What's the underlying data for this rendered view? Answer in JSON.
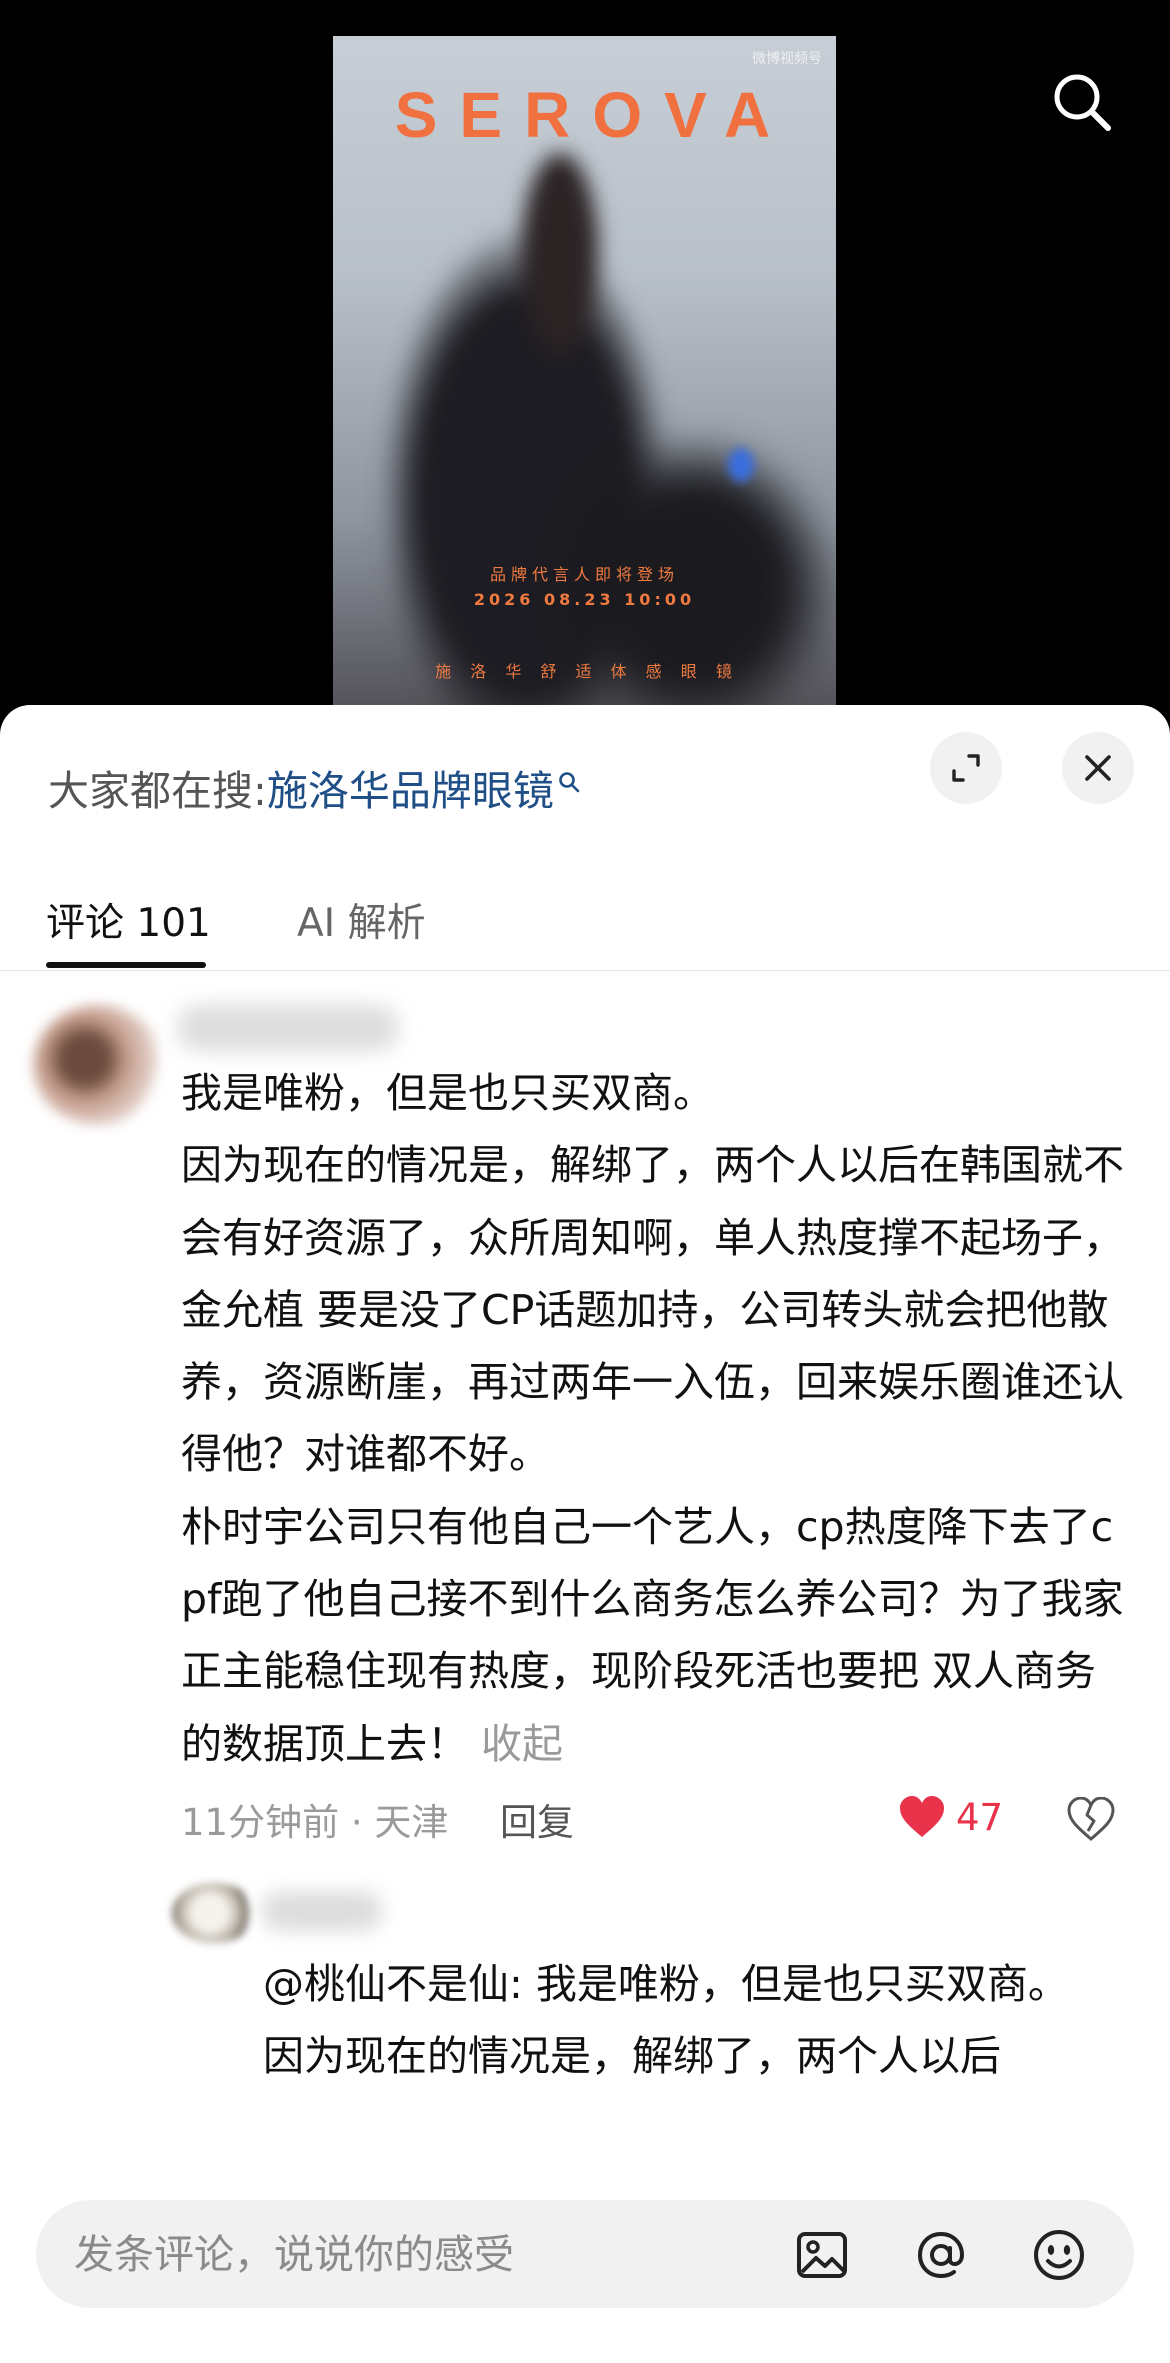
{
  "poster": {
    "brand": "SEROVA",
    "watermark": "微博视频号",
    "line1": "品牌代言人即将登场",
    "line2": "2026 08.23 10:00",
    "line3": "施 洛 华   舒 适 体 感 眼 镜"
  },
  "panel": {
    "search_prefix": "大家都在搜:",
    "search_keyword": "施洛华品牌眼镜"
  },
  "tabs": [
    {
      "label": "评论 101"
    },
    {
      "label": "AI 解析"
    }
  ],
  "comment": {
    "text": "我是唯粉，但是也只买双商。\n因为现在的情况是，解绑了，两个人以后在韩国就不会有好资源了，众所周知啊，单人热度撑不起场子， 金允植 要是没了CP话题加持，公司转头就会把他散养，资源断崖，再过两年一入伍，回来娱乐圈谁还认得他？对谁都不好。\n朴时宇公司只有他自己一个艺人，cp热度降下去了cpf跑了他自己接不到什么商务怎么养公司？为了我家正主能稳住现有热度，现阶段死活也要把 双人商务  的数据顶上去！",
    "collapse_label": "收起",
    "time_location": "11分钟前 · 天津",
    "reply_label": "回复",
    "like_count": "47"
  },
  "reply": {
    "text": "@桃仙不是仙: 我是唯粉，但是也只买双商。\n因为现在的情况是，解绑了，两个人以后"
  },
  "input": {
    "placeholder": "发条评论，说说你的感受"
  },
  "colors": {
    "accent_orange": "#f0703f",
    "link_blue": "#1f4f86",
    "like_red": "#e8334b"
  }
}
